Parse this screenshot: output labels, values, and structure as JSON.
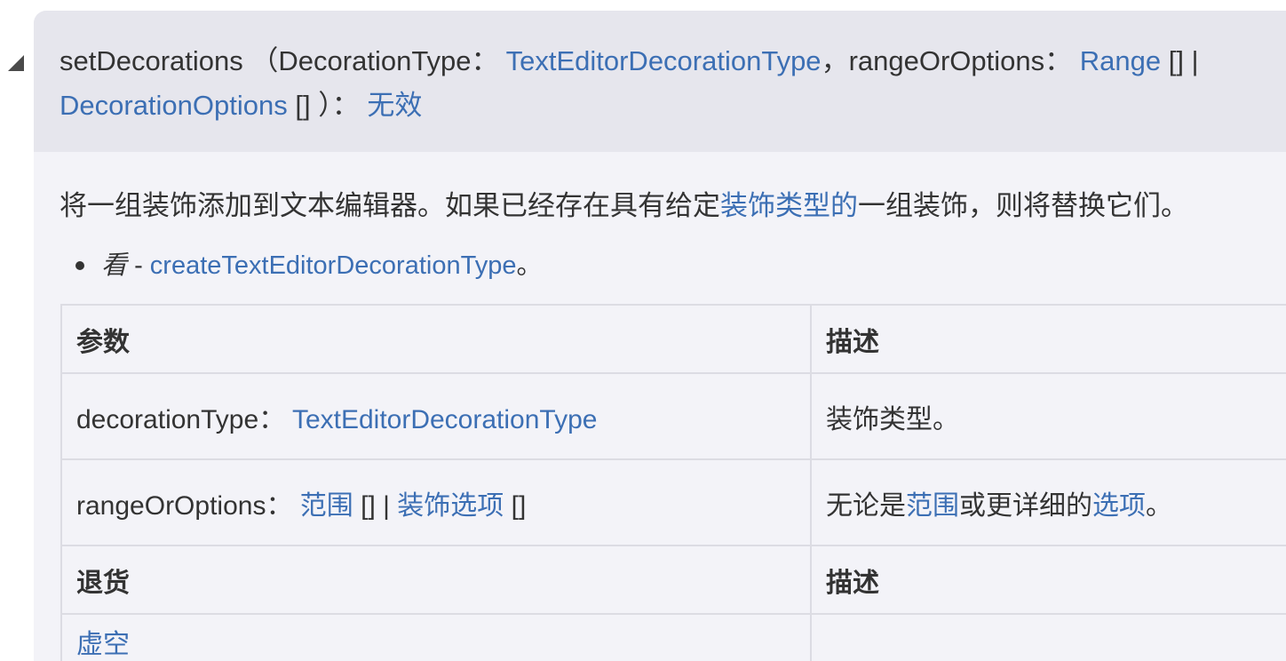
{
  "signature": {
    "method": "setDecorations",
    "open_paren": " （",
    "param1_name": "DecorationType",
    "colon": "：",
    "param1_type": "TextEditorDecorationType",
    "comma": "，",
    "param2_name": "rangeOrOptions",
    "param2_type_a": "Range",
    "arr_bar": " [] |",
    "param2_type_b": "DecorationOptions",
    "close": " [] ）：",
    "return_type": "无效"
  },
  "description": {
    "before_link": "将一组装饰添加到文本编辑器。如果已经存在具有给定",
    "link": "装饰类型的",
    "after_link": "一组装饰，则将替换它们。"
  },
  "see": {
    "label": "看",
    "sep": " - ",
    "link": "createTextEditorDecorationType",
    "end": "。"
  },
  "params_table": {
    "header": {
      "col1": "参数",
      "col2": "描述"
    },
    "rows": [
      {
        "name": "decorationType",
        "colon": "：",
        "type_link": "TextEditorDecorationType",
        "desc": "装饰类型。"
      },
      {
        "name": "rangeOrOptions",
        "colon": "：",
        "type_link_a": "范围",
        "mid": " [] |",
        "type_link_b": "装饰选项",
        "end": " []",
        "desc_before": "无论是",
        "desc_link_a": "范围",
        "desc_mid": "或更详细的",
        "desc_link_b": "选项",
        "desc_end": "。"
      }
    ]
  },
  "returns_table": {
    "header": {
      "col1": "退货",
      "col2": "描述"
    },
    "row": {
      "type_link": "虚空",
      "desc": ""
    }
  },
  "colors": {
    "link": "#3c6fb4",
    "signature_bg": "#e6e6ed",
    "card_bg": "#f3f3f8",
    "text": "#333333"
  }
}
